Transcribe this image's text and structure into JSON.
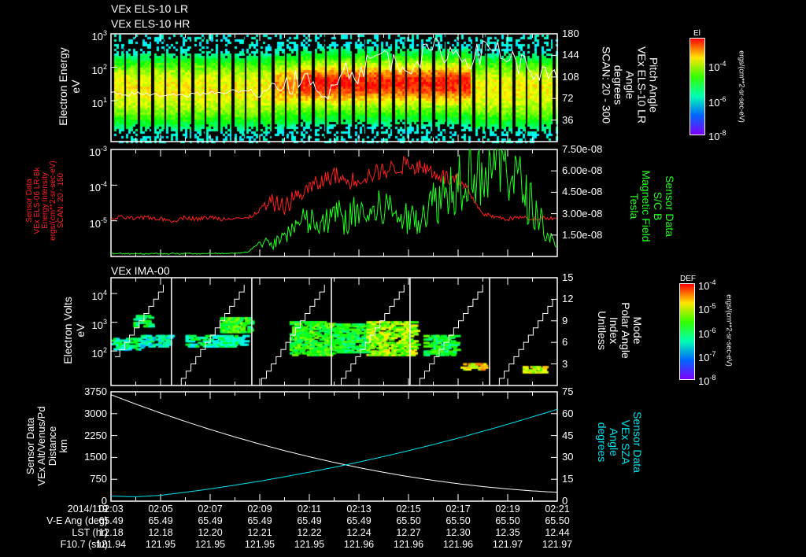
{
  "titles": {
    "panel1_line1": "VEx ELS-10 LR",
    "panel1_line2": "VEx ELS-10 HR",
    "panel3": "VEx IMA-00"
  },
  "panel1": {
    "left_title": [
      "Electron Energy",
      "eV"
    ],
    "right_title": [
      "Pitch Angle",
      "VEx ELS-10 LR",
      "Angle",
      "degrees",
      "SCAN: 20 - 300"
    ],
    "left_ticks": [
      {
        "v": 3,
        "base": "10",
        "exp": "3"
      },
      {
        "v": 2,
        "base": "10",
        "exp": "2"
      },
      {
        "v": 1,
        "base": "10",
        "exp": "1"
      }
    ],
    "right_ticks": [
      {
        "v": 180,
        "label": "180"
      },
      {
        "v": 144,
        "label": "144"
      },
      {
        "v": 108,
        "label": "108"
      },
      {
        "v": 72,
        "label": "72"
      },
      {
        "v": 36,
        "label": "36"
      }
    ],
    "colorbar": {
      "title": "El",
      "units": "ergs/(cm**2-sr-sec-eV)",
      "ticks": [
        {
          "base": "10",
          "exp": "-4",
          "frac": 0.72
        },
        {
          "base": "10",
          "exp": "-6",
          "frac": 0.35
        },
        {
          "base": "10",
          "exp": "-8",
          "frac": 0.0
        }
      ]
    }
  },
  "panel2": {
    "left_title": [
      "Sensor Data",
      "VEx ELS-06 LR-Bk",
      "Energy Intensity",
      "ergs/(cm**2-sr-sec-eV)",
      "SCAN: 20 - 150"
    ],
    "right_title": [
      "Sensor Data",
      "S/C B",
      "Magnetic Field",
      "Tesla"
    ],
    "left_ticks": [
      {
        "v": -3,
        "base": "10",
        "exp": "-3"
      },
      {
        "v": -4,
        "base": "10",
        "exp": "-4"
      },
      {
        "v": -5,
        "base": "10",
        "exp": "-5"
      }
    ],
    "right_ticks": [
      {
        "v": 7.5,
        "label": "7.50e-08"
      },
      {
        "v": 6.0,
        "label": "6.00e-08"
      },
      {
        "v": 4.5,
        "label": "4.50e-08"
      },
      {
        "v": 3.0,
        "label": "3.00e-08"
      },
      {
        "v": 1.5,
        "label": "1.50e-08"
      }
    ]
  },
  "panel3": {
    "left_title": [
      "Electron Volts",
      "eV"
    ],
    "right_title": [
      "Mode",
      "Polar Angle",
      "Index",
      "Unitless"
    ],
    "left_ticks": [
      {
        "v": 4,
        "base": "10",
        "exp": "4"
      },
      {
        "v": 3,
        "base": "10",
        "exp": "3"
      },
      {
        "v": 2,
        "base": "10",
        "exp": "2"
      }
    ],
    "right_ticks": [
      {
        "v": 15,
        "label": "15"
      },
      {
        "v": 12,
        "label": "12"
      },
      {
        "v": 9,
        "label": "9"
      },
      {
        "v": 6,
        "label": "6"
      },
      {
        "v": 3,
        "label": "3"
      }
    ],
    "colorbar": {
      "title": "DEF",
      "units": "ergs/(cm**2-sr-sec-eV)",
      "ticks": [
        {
          "base": "10",
          "exp": "-4",
          "frac": 1.0
        },
        {
          "base": "10",
          "exp": "-5",
          "frac": 0.75
        },
        {
          "base": "10",
          "exp": "-6",
          "frac": 0.5
        },
        {
          "base": "10",
          "exp": "-7",
          "frac": 0.25
        },
        {
          "base": "10",
          "exp": "-8",
          "frac": 0.0
        }
      ]
    }
  },
  "panel4": {
    "left_title": [
      "Sensor Data",
      "VEx Alt/Venus/Pd",
      "Distance",
      "km"
    ],
    "right_title": [
      "Sensor Data",
      "VEx SZA",
      "Angle",
      "degrees"
    ],
    "left_ticks": [
      {
        "v": 3750,
        "label": "3750"
      },
      {
        "v": 3000,
        "label": "3000"
      },
      {
        "v": 2250,
        "label": "2250"
      },
      {
        "v": 1500,
        "label": "1500"
      },
      {
        "v": 750,
        "label": "750"
      },
      {
        "v": 0,
        "label": "0"
      }
    ],
    "right_ticks": [
      {
        "v": 75,
        "label": "75"
      },
      {
        "v": 60,
        "label": "60"
      },
      {
        "v": 45,
        "label": "45"
      },
      {
        "v": 30,
        "label": "30"
      },
      {
        "v": 15,
        "label": "15"
      },
      {
        "v": 0,
        "label": "0"
      }
    ]
  },
  "table": {
    "labels": [
      "2014/119",
      "V-E Ang (deg)",
      "LST (hr)",
      "F10.7 (sfu)"
    ],
    "times": [
      "02:03",
      "02:05",
      "02:07",
      "02:09",
      "02:11",
      "02:13",
      "02:15",
      "02:17",
      "02:19",
      "02:21"
    ],
    "ve_ang": [
      "65.49",
      "65.49",
      "65.49",
      "65.49",
      "65.49",
      "65.49",
      "65.50",
      "65.50",
      "65.50",
      "65.50"
    ],
    "lst": [
      "12.18",
      "12.18",
      "12.20",
      "12.21",
      "12.22",
      "12.24",
      "12.27",
      "12.30",
      "12.35",
      "12.44"
    ],
    "f107": [
      "121.94",
      "121.95",
      "121.95",
      "121.95",
      "121.95",
      "121.96",
      "121.96",
      "121.96",
      "121.97",
      "121.97"
    ]
  },
  "colors": {
    "background": "#000000",
    "axes": "#ffffff",
    "red_series": "#ff2020",
    "green_series": "#20ff20",
    "cyan_series": "#00e5ee"
  },
  "chart_data": [
    {
      "type": "heatmap",
      "title": "VEx ELS-10 LR / VEx ELS-10 HR",
      "xlabel": "UT 2014/119",
      "xlim_minutes_after_0203": [
        0,
        18
      ],
      "ylabel": "Electron Energy (eV)",
      "yscale": "log",
      "ylim": [
        0.6,
        1000
      ],
      "y2label": "Pitch Angle (degrees)",
      "y2lim": [
        0,
        180
      ],
      "peak_energy_log10": 1.4,
      "enhanced_red_region_minutes": [
        7.5,
        14.5
      ],
      "overlay_pitch_angle_t_step_min": 0.5,
      "overlay_pitch_angle": [
        80,
        78,
        80,
        79,
        78,
        80,
        77,
        80,
        82,
        78,
        85,
        88,
        75,
        95,
        85,
        105,
        95,
        70,
        110,
        120,
        115,
        135,
        150,
        125,
        130,
        140,
        155,
        150,
        145,
        140,
        150,
        160,
        140,
        130,
        120,
        110,
        100
      ]
    },
    {
      "type": "line",
      "xlim_minutes_after_0203": [
        0,
        18
      ],
      "t_step_min": 0.5,
      "series": [
        {
          "name": "VEx ELS-06 LR-Bk Energy Intensity (log10)",
          "axis": "left",
          "color": "red",
          "values": [
            -4.95,
            -4.9,
            -4.95,
            -4.9,
            -4.95,
            -5.0,
            -4.9,
            -4.95,
            -4.9,
            -4.95,
            -4.9,
            -4.95,
            -4.7,
            -4.5,
            -4.6,
            -4.3,
            -4.1,
            -3.9,
            -3.7,
            -3.9,
            -3.8,
            -3.7,
            -3.6,
            -3.5,
            -3.4,
            -3.5,
            -3.6,
            -3.8,
            -3.9,
            -4.3,
            -4.8,
            -4.9,
            -4.95,
            -4.9,
            -4.95,
            -4.9,
            -4.95
          ]
        },
        {
          "name": "S/C B Magnetic Field (1e-8 T)",
          "axis": "right",
          "color": "green",
          "values": [
            0.2,
            0.2,
            0.2,
            0.2,
            0.2,
            0.2,
            0.2,
            0.2,
            0.2,
            0.2,
            0.2,
            0.3,
            1.0,
            0.8,
            1.5,
            2.2,
            2.5,
            2.0,
            3.0,
            2.5,
            3.2,
            2.8,
            3.5,
            3.0,
            2.5,
            3.0,
            3.8,
            4.5,
            5.5,
            6.5,
            6.0,
            7.0,
            6.5,
            5.0,
            3.5,
            2.0,
            0.4
          ]
        }
      ],
      "ylim_log10": [
        -6,
        -3
      ],
      "y2lim": [
        0,
        7.5
      ]
    },
    {
      "type": "heatmap",
      "title": "VEx IMA-00",
      "ylabel": "Electron Volts (eV)",
      "yscale": "log",
      "ylim_log10": [
        0.8,
        4.55
      ],
      "y2label": "Mode Polar Angle Index",
      "y2lim": [
        0,
        15
      ],
      "mode_change_minutes": [
        2.44,
        5.68,
        8.89,
        12.06,
        15.27
      ],
      "clusters": [
        {
          "t": [
            0.0,
            1.3
          ],
          "logE": [
            2.1,
            2.5
          ],
          "level": 0.45
        },
        {
          "t": [
            0.9,
            1.6
          ],
          "logE": [
            2.9,
            3.3
          ],
          "level": 0.5
        },
        {
          "t": [
            1.2,
            2.4
          ],
          "logE": [
            2.2,
            2.6
          ],
          "level": 0.4
        },
        {
          "t": [
            3.0,
            5.3
          ],
          "logE": [
            2.2,
            2.6
          ],
          "level": 0.45
        },
        {
          "t": [
            4.4,
            5.6
          ],
          "logE": [
            2.7,
            3.2
          ],
          "level": 0.6
        },
        {
          "t": [
            7.2,
            8.8
          ],
          "logE": [
            1.9,
            3.1
          ],
          "level": 0.6
        },
        {
          "t": [
            9.0,
            10.3
          ],
          "logE": [
            2.0,
            3.0
          ],
          "level": 0.55
        },
        {
          "t": [
            10.3,
            12.2
          ],
          "logE": [
            1.9,
            3.1
          ],
          "level": 0.7
        },
        {
          "t": [
            12.6,
            13.8
          ],
          "logE": [
            1.9,
            2.6
          ],
          "level": 0.55
        },
        {
          "t": [
            14.1,
            15.0
          ],
          "logE": [
            1.4,
            1.6
          ],
          "level": 0.8
        },
        {
          "t": [
            16.6,
            17.5
          ],
          "logE": [
            1.3,
            1.5
          ],
          "level": 0.75
        }
      ]
    },
    {
      "type": "line",
      "xlim_minutes_after_0203": [
        0,
        18
      ],
      "t_step_min": 1,
      "series": [
        {
          "name": "VEx Alt/Venus/Pd Distance (km)",
          "axis": "left",
          "color": "white",
          "values": [
            3650,
            3328,
            3022,
            2732,
            2458,
            2200,
            1958,
            1732,
            1522,
            1328,
            1150,
            988,
            842,
            712,
            598,
            500,
            418,
            352,
            302
          ]
        },
        {
          "name": "VEx SZA Angle (degrees)",
          "axis": "right",
          "color": "cyan",
          "values": [
            3.5,
            3.0,
            4.0,
            6.1,
            8.4,
            11.0,
            13.7,
            16.7,
            19.9,
            23.2,
            26.8,
            30.6,
            34.6,
            38.8,
            43.2,
            47.9,
            52.7,
            57.8,
            63.0
          ]
        }
      ],
      "ylim": [
        0,
        3750
      ],
      "y2lim": [
        0,
        75
      ]
    }
  ]
}
